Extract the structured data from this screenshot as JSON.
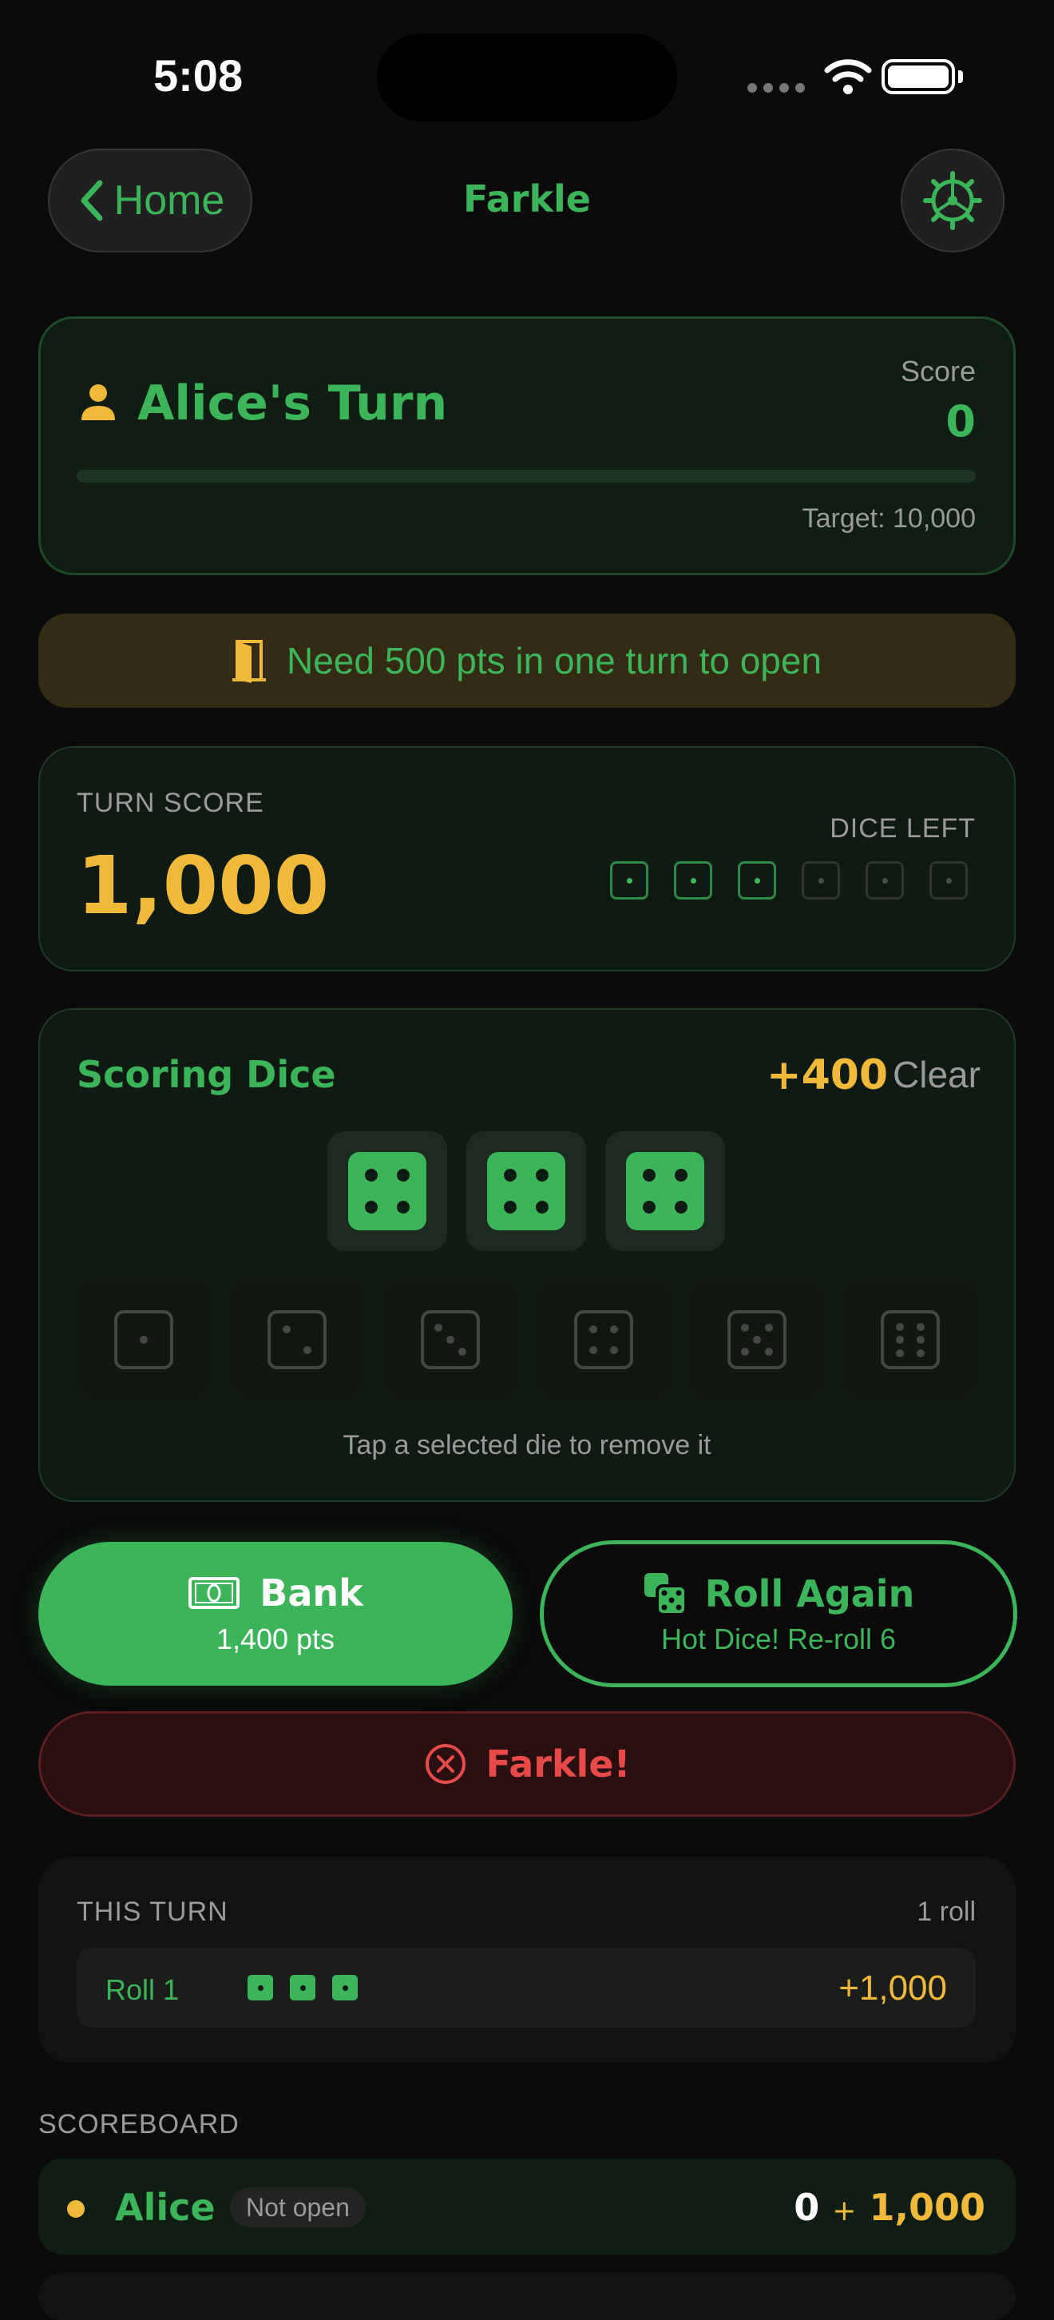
{
  "status_bar": {
    "time": "5:08"
  },
  "nav": {
    "back_label": "Home",
    "title": "Farkle",
    "settings_icon": "gear-icon"
  },
  "turn": {
    "player_label": "Alice's Turn",
    "score_label": "Score",
    "score_value": "0",
    "progress_fraction": 0,
    "target_label": "Target: 10,000"
  },
  "open_banner": {
    "text": "Need 500 pts in one turn to open"
  },
  "turn_score": {
    "label": "TURN SCORE",
    "value": "1,000",
    "dice_left_label": "DICE LEFT",
    "dice_left": [
      true,
      true,
      true,
      false,
      false,
      false
    ]
  },
  "scoring_dice": {
    "title": "Scoring Dice",
    "points": "+400",
    "clear_label": "Clear",
    "selected": [
      4,
      4,
      4
    ],
    "pickable": [
      1,
      2,
      3,
      4,
      5,
      6
    ],
    "hint": "Tap a selected die to remove it"
  },
  "actions": {
    "bank_label": "Bank",
    "bank_sub": "1,400 pts",
    "roll_label": "Roll Again",
    "roll_sub": "Hot Dice! Re-roll 6",
    "farkle_label": "Farkle!"
  },
  "this_turn": {
    "label": "THIS TURN",
    "roll_count": "1 roll",
    "rolls": [
      {
        "name": "Roll 1",
        "dice_count": 3,
        "points": "+1,000"
      }
    ]
  },
  "scoreboard": {
    "label": "SCOREBOARD",
    "players": [
      {
        "name": "Alice",
        "badge": "Not open",
        "score": "0",
        "plus": "+",
        "pending": "1,000"
      }
    ]
  },
  "colors": {
    "accent": "#3cb45a",
    "gold": "#f0b93a",
    "danger": "#e84a4a",
    "background": "#0a0b0a"
  }
}
